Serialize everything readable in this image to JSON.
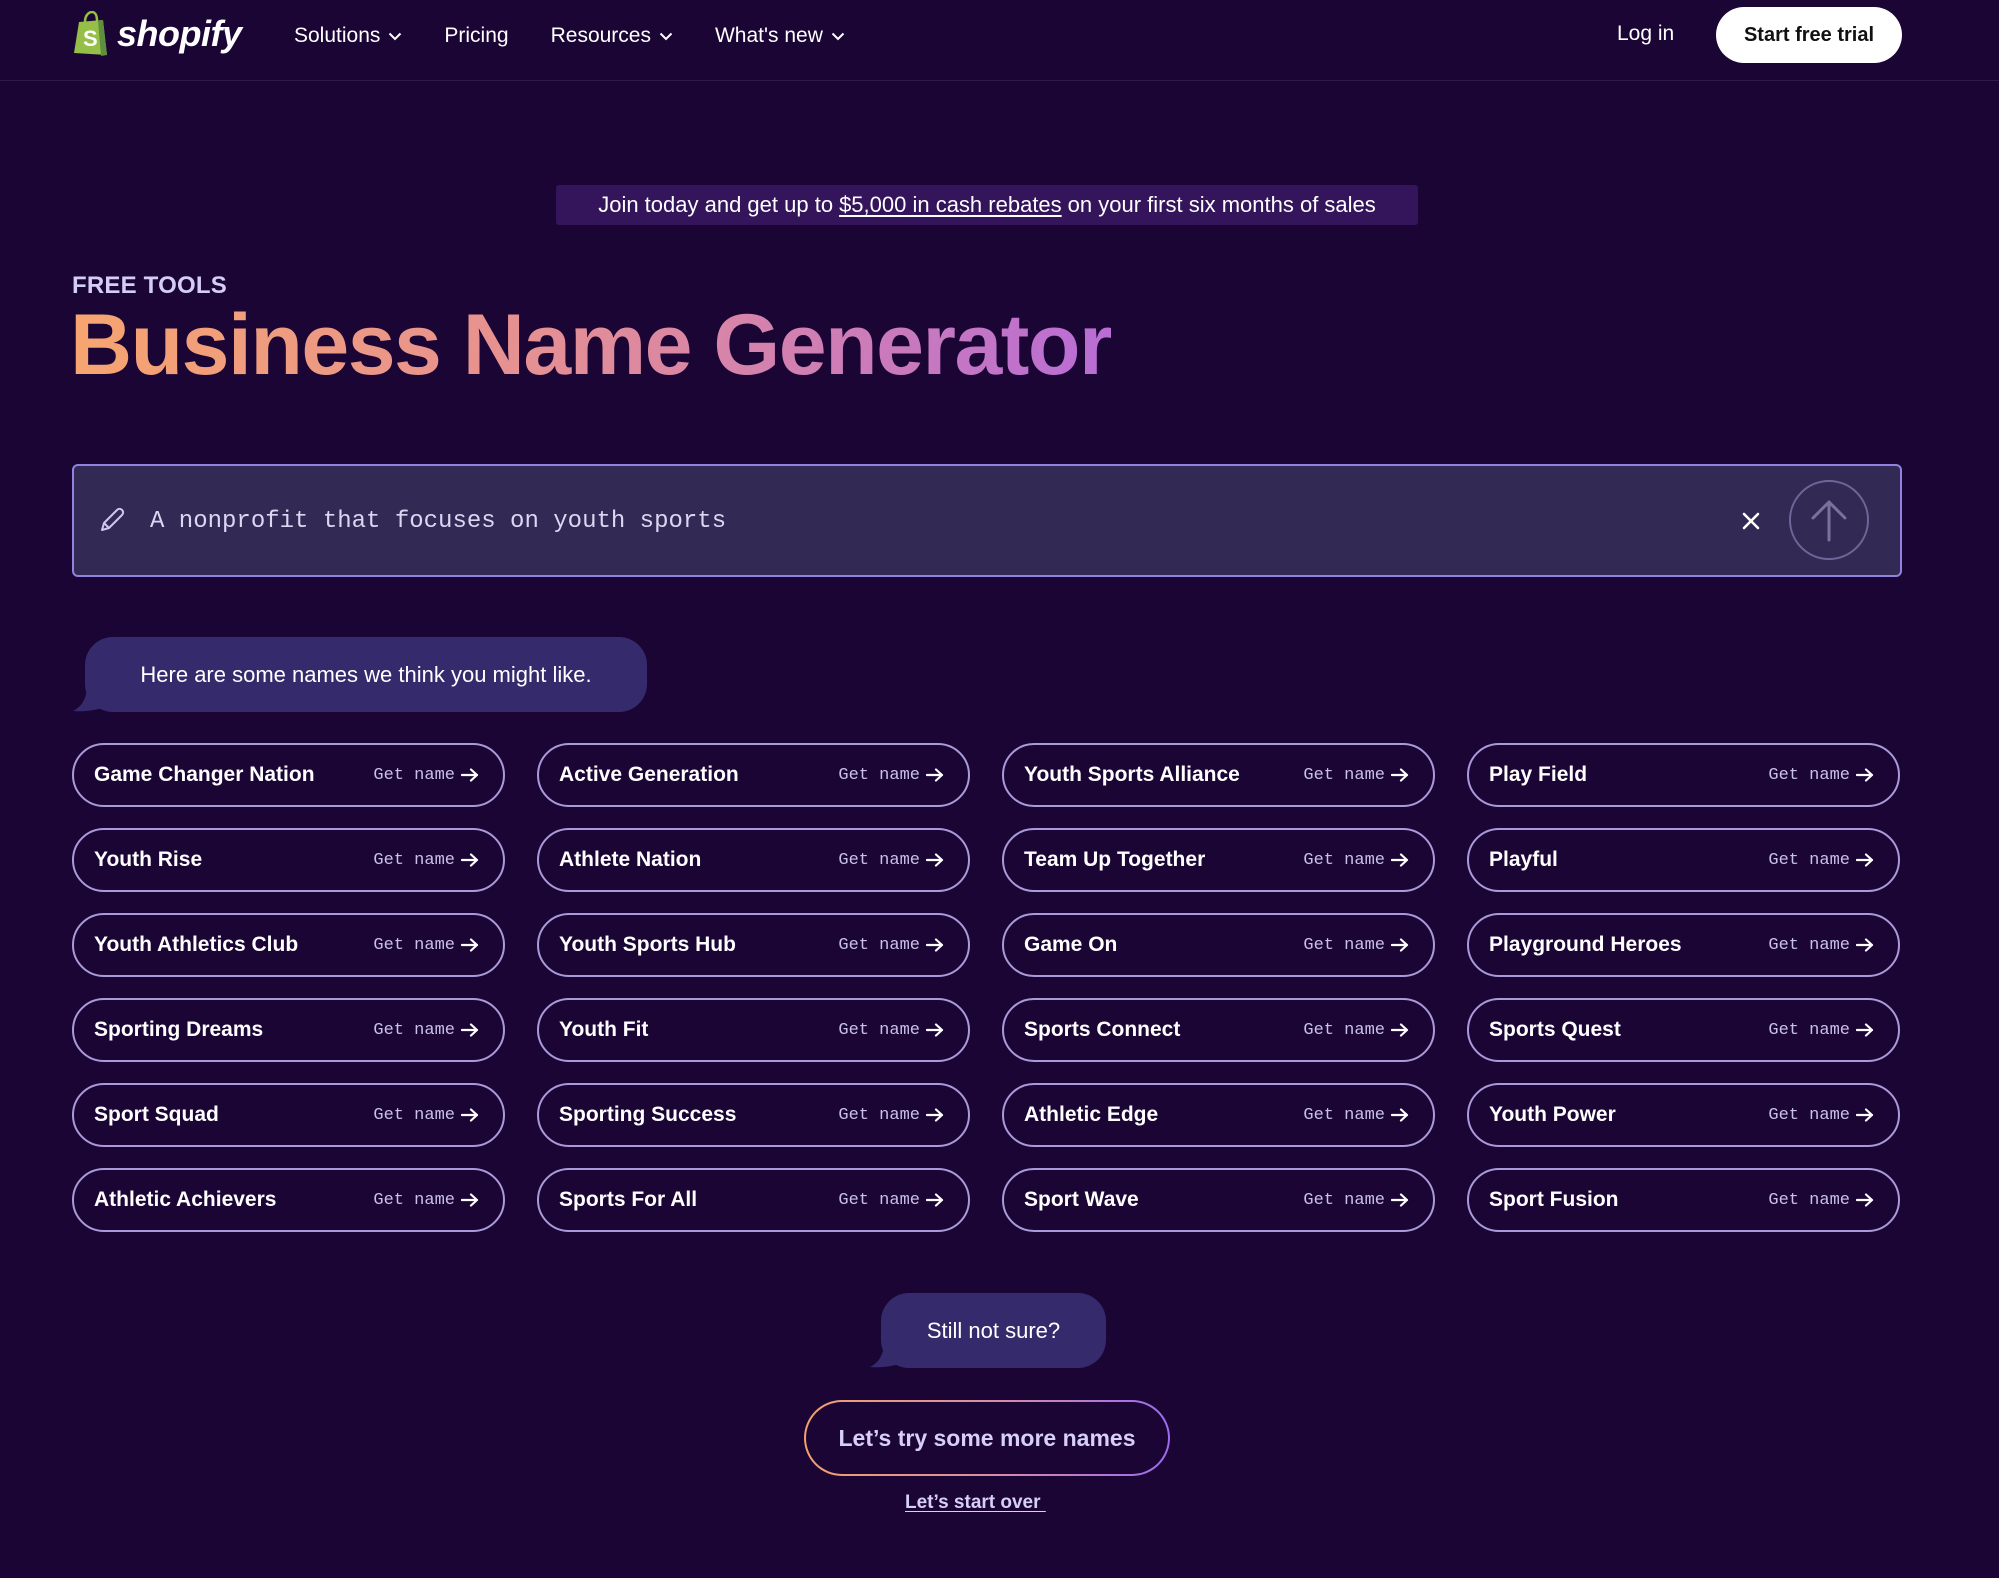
{
  "nav": {
    "brand": "shopify",
    "links": [
      {
        "label": "Solutions",
        "has_dropdown": true
      },
      {
        "label": "Pricing",
        "has_dropdown": false
      },
      {
        "label": "Resources",
        "has_dropdown": true
      },
      {
        "label": "What's new",
        "has_dropdown": true
      }
    ],
    "login_label": "Log in",
    "trial_label": "Start free trial"
  },
  "promo": {
    "prefix": "Join today and get up to",
    "link_text": "$5,000 in cash rebates",
    "suffix": "on your first six months of sales"
  },
  "header": {
    "eyebrow": "FREE TOOLS",
    "title": "Business Name Generator"
  },
  "prompt": {
    "value": "A nonprofit that focuses on youth sports",
    "icons": {
      "leading": "pencil-icon",
      "clear": "close-icon",
      "submit": "arrow-up-icon"
    }
  },
  "results": {
    "intro_bubble": "Here are some names we think you might like.",
    "action_label": "Get name",
    "names": [
      "Game Changer Nation",
      "Active Generation",
      "Youth Sports Alliance",
      "Play Field",
      "Youth Rise",
      "Athlete Nation",
      "Team Up Together",
      "Playful",
      "Youth Athletics Club",
      "Youth Sports Hub",
      "Game On",
      "Playground Heroes",
      "Sporting Dreams",
      "Youth Fit",
      "Sports Connect",
      "Sports Quest",
      "Sport Squad",
      "Sporting Success",
      "Athletic Edge",
      "Youth Power",
      "Athletic Achievers",
      "Sports For All",
      "Sport Wave",
      "Sport Fusion"
    ]
  },
  "footer_actions": {
    "bubble": "Still not sure?",
    "more_label": "Let’s try some more names",
    "start_over_label": "Let’s start over "
  },
  "colors": {
    "background": "#1b0534",
    "brand_green": "#95bf47",
    "input_bg": "#322955",
    "input_border": "#8f83df",
    "bubble_bg": "#352a6c",
    "title_gradient_start": "#f7a56f",
    "title_gradient_end": "#b86cd6"
  }
}
